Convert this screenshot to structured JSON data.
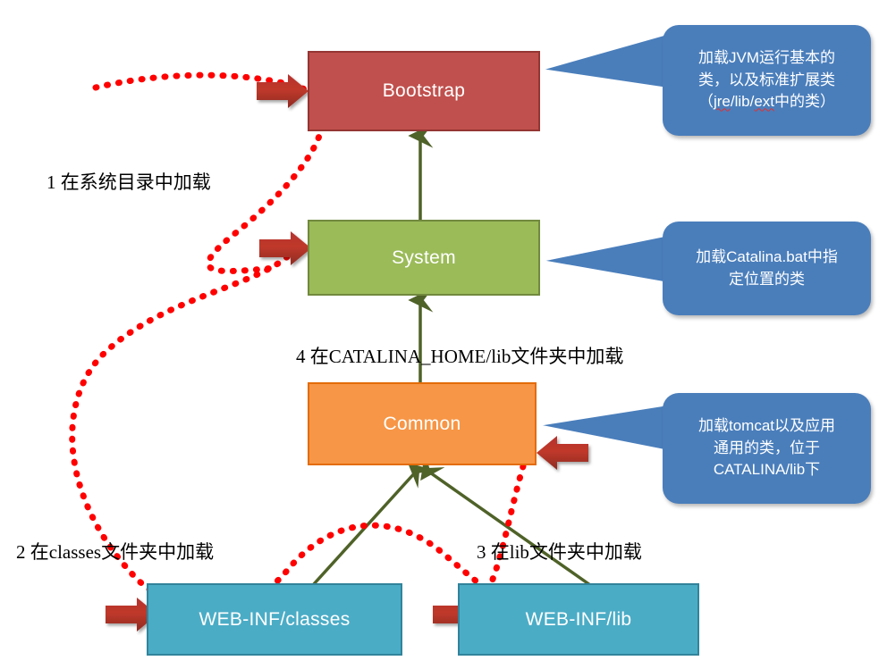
{
  "diagram": {
    "title": "Tomcat ClassLoader hierarchy",
    "background": "#ffffff",
    "colors": {
      "bootstrap": "#c0504d",
      "system": "#9bbb59",
      "common": "#f79646",
      "webinf": "#4bacc6",
      "callout": "#4a7ebb",
      "connector": "#4f6228",
      "flow": "#ff0000",
      "arrow": "#c0392b"
    }
  },
  "nodes": {
    "bootstrap": {
      "label": "Bootstrap"
    },
    "system": {
      "label": "System"
    },
    "common": {
      "label": "Common"
    },
    "classes": {
      "label": "WEB-INF/classes"
    },
    "lib": {
      "label": "WEB-INF/lib"
    }
  },
  "callouts": {
    "bootstrap": {
      "line1": "加载JVM运行基本的",
      "line2": "类，以及标准扩展类",
      "line3_pre": "（",
      "line3_a": "jre",
      "line3_mid": "/lib/",
      "line3_b": "ext",
      "line3_post": "中的类）"
    },
    "system": {
      "line1": "加载Catalina.bat中指",
      "line2": "定位置的类"
    },
    "common": {
      "line1": "加载tomcat以及应用",
      "line2": "通用的类，位于",
      "line3": "CATALINA/lib下"
    }
  },
  "steps": {
    "step1": "1 在系统目录中加载",
    "step2": "2 在classes文件夹中加载",
    "step3": "3 在lib文件夹中加载",
    "step4": "4 在CATALINA_HOME/lib文件夹中加载"
  }
}
